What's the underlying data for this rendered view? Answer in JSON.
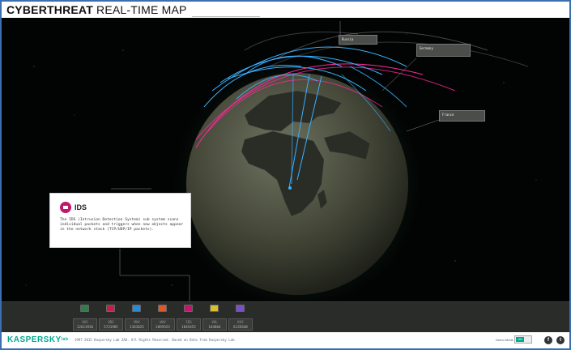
{
  "header": {
    "title_bold": "CYBERTHREAT",
    "title_light": "REAL-TIME MAP"
  },
  "callouts": [
    {
      "title": "Russia",
      "subtitle": ""
    },
    {
      "title": "Germany",
      "subtitle": ""
    },
    {
      "title": "France",
      "subtitle": ""
    }
  ],
  "ids_panel": {
    "title": "IDS",
    "description": "The IDS (Intrusion Detection System) sub system scans individual packets and triggers when new objects appear in the network stack (TCP/UDP/IP packets)."
  },
  "stats": [
    {
      "label": "OAS",
      "value": "12613936",
      "icon": "shield-icon",
      "color": "#2f7d4a"
    },
    {
      "label": "ODS",
      "value": "5731985",
      "icon": "scan-icon",
      "color": "#c0204a"
    },
    {
      "label": "MAV",
      "value": "1363825",
      "icon": "mail-icon",
      "color": "#2a8ad4"
    },
    {
      "label": "WAV",
      "value": "2095923",
      "icon": "web-icon",
      "color": "#e0582a"
    },
    {
      "label": "IDS",
      "value": "1845452",
      "icon": "ids-icon",
      "color": "#c0186a"
    },
    {
      "label": "VUL",
      "value": "184864",
      "icon": "vulnerability-icon",
      "color": "#d8c030"
    },
    {
      "label": "KAS",
      "value": "6135648",
      "icon": "spam-icon",
      "color": "#7a50c8"
    }
  ],
  "footer": {
    "logo": "KASPERSKY",
    "logo_lab": "lab",
    "copyright": "1997-2015 Kaspersky Lab ZAO. All Rights Reserved. Based on Data from Kaspersky Lab",
    "demo_label": "Demo Mode",
    "demo_state": "ON",
    "social": [
      "f",
      "t"
    ]
  },
  "colors": {
    "accent": "#00a88e",
    "ids": "#c0186a",
    "arc_blue": "#3ab0ff",
    "arc_pink": "#ff2a9a"
  }
}
